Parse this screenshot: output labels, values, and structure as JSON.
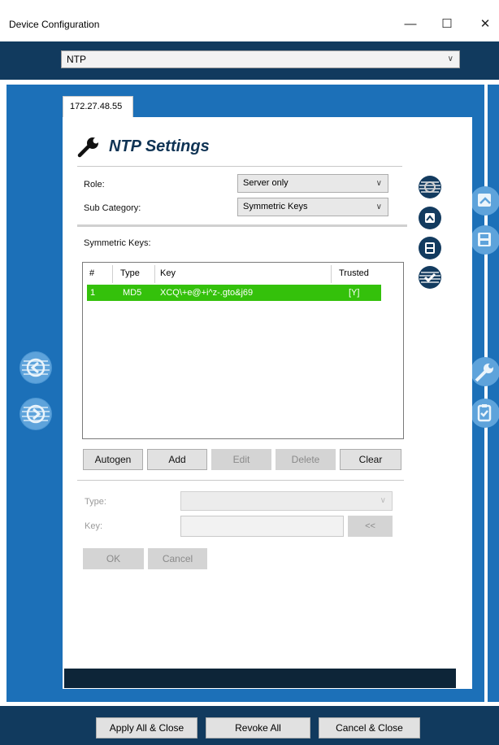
{
  "window": {
    "title": "Device Configuration",
    "min_glyph": "—",
    "max_glyph": "☐",
    "close_glyph": "✕"
  },
  "category": {
    "value": "NTP",
    "chevron": "∨"
  },
  "tab": {
    "label": "172.27.48.55"
  },
  "page": {
    "title": "NTP Settings"
  },
  "form": {
    "role_label": "Role:",
    "role_value": "Server only",
    "subcat_label": "Sub Category:",
    "subcat_value": "Symmetric Keys",
    "keys_label": "Symmetric Keys:",
    "chevron": "∨"
  },
  "table": {
    "columns": [
      "#",
      "Type",
      "Key",
      "Trusted"
    ],
    "rows": [
      {
        "num": "1",
        "type": "MD5",
        "key": "XCQ\\+e@+i^z-.gto&j69",
        "trusted": "[Y]"
      }
    ]
  },
  "actions": {
    "autogen": "Autogen",
    "add": "Add",
    "edit": "Edit",
    "delete": "Delete",
    "clear": "Clear"
  },
  "editor": {
    "type_label": "Type:",
    "type_value": "",
    "key_label": "Key:",
    "key_value": "",
    "copy_button": "<<",
    "ok": "OK",
    "cancel": "Cancel"
  },
  "footer": {
    "apply_all": "Apply All & Close",
    "revoke_all": "Revoke All",
    "cancel_close": "Cancel & Close"
  },
  "colors": {
    "dark_navy": "#113a5e",
    "panel_blue": "#1c70b8",
    "selected_row": "#34c10b"
  },
  "icons": {
    "side_left": [
      "arrow-left-icon",
      "arrow-right-icon"
    ],
    "side_right": [
      "open-file-icon",
      "save-icon",
      "wrench-icon",
      "clipboard-icon"
    ],
    "panel_tools": [
      "refresh-icon",
      "open-file-icon",
      "save-icon",
      "check-icon"
    ]
  }
}
